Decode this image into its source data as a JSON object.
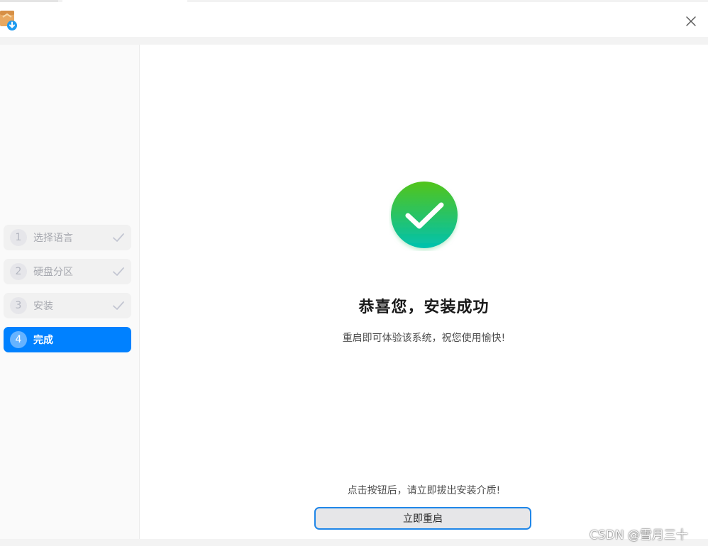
{
  "window": {
    "close_icon": "close-icon",
    "app_icon": "installer-package-icon"
  },
  "steps": [
    {
      "number": "1",
      "label": "选择语言",
      "state": "done"
    },
    {
      "number": "2",
      "label": "硬盘分区",
      "state": "done"
    },
    {
      "number": "3",
      "label": "安装",
      "state": "done"
    },
    {
      "number": "4",
      "label": "完成",
      "state": "active"
    }
  ],
  "main": {
    "success_icon": "check-circle-icon",
    "headline": "恭喜您，安装成功",
    "subtext": "重启即可体验该系统，祝您使用愉快!",
    "hint": "点击按钮后，请立即拔出安装介质!",
    "reboot_label": "立即重启"
  },
  "colors": {
    "accent": "#0081ff",
    "success_top": "#52c41a",
    "success_bottom": "#00c2b0"
  },
  "watermark": "CSDN @雪月三十"
}
